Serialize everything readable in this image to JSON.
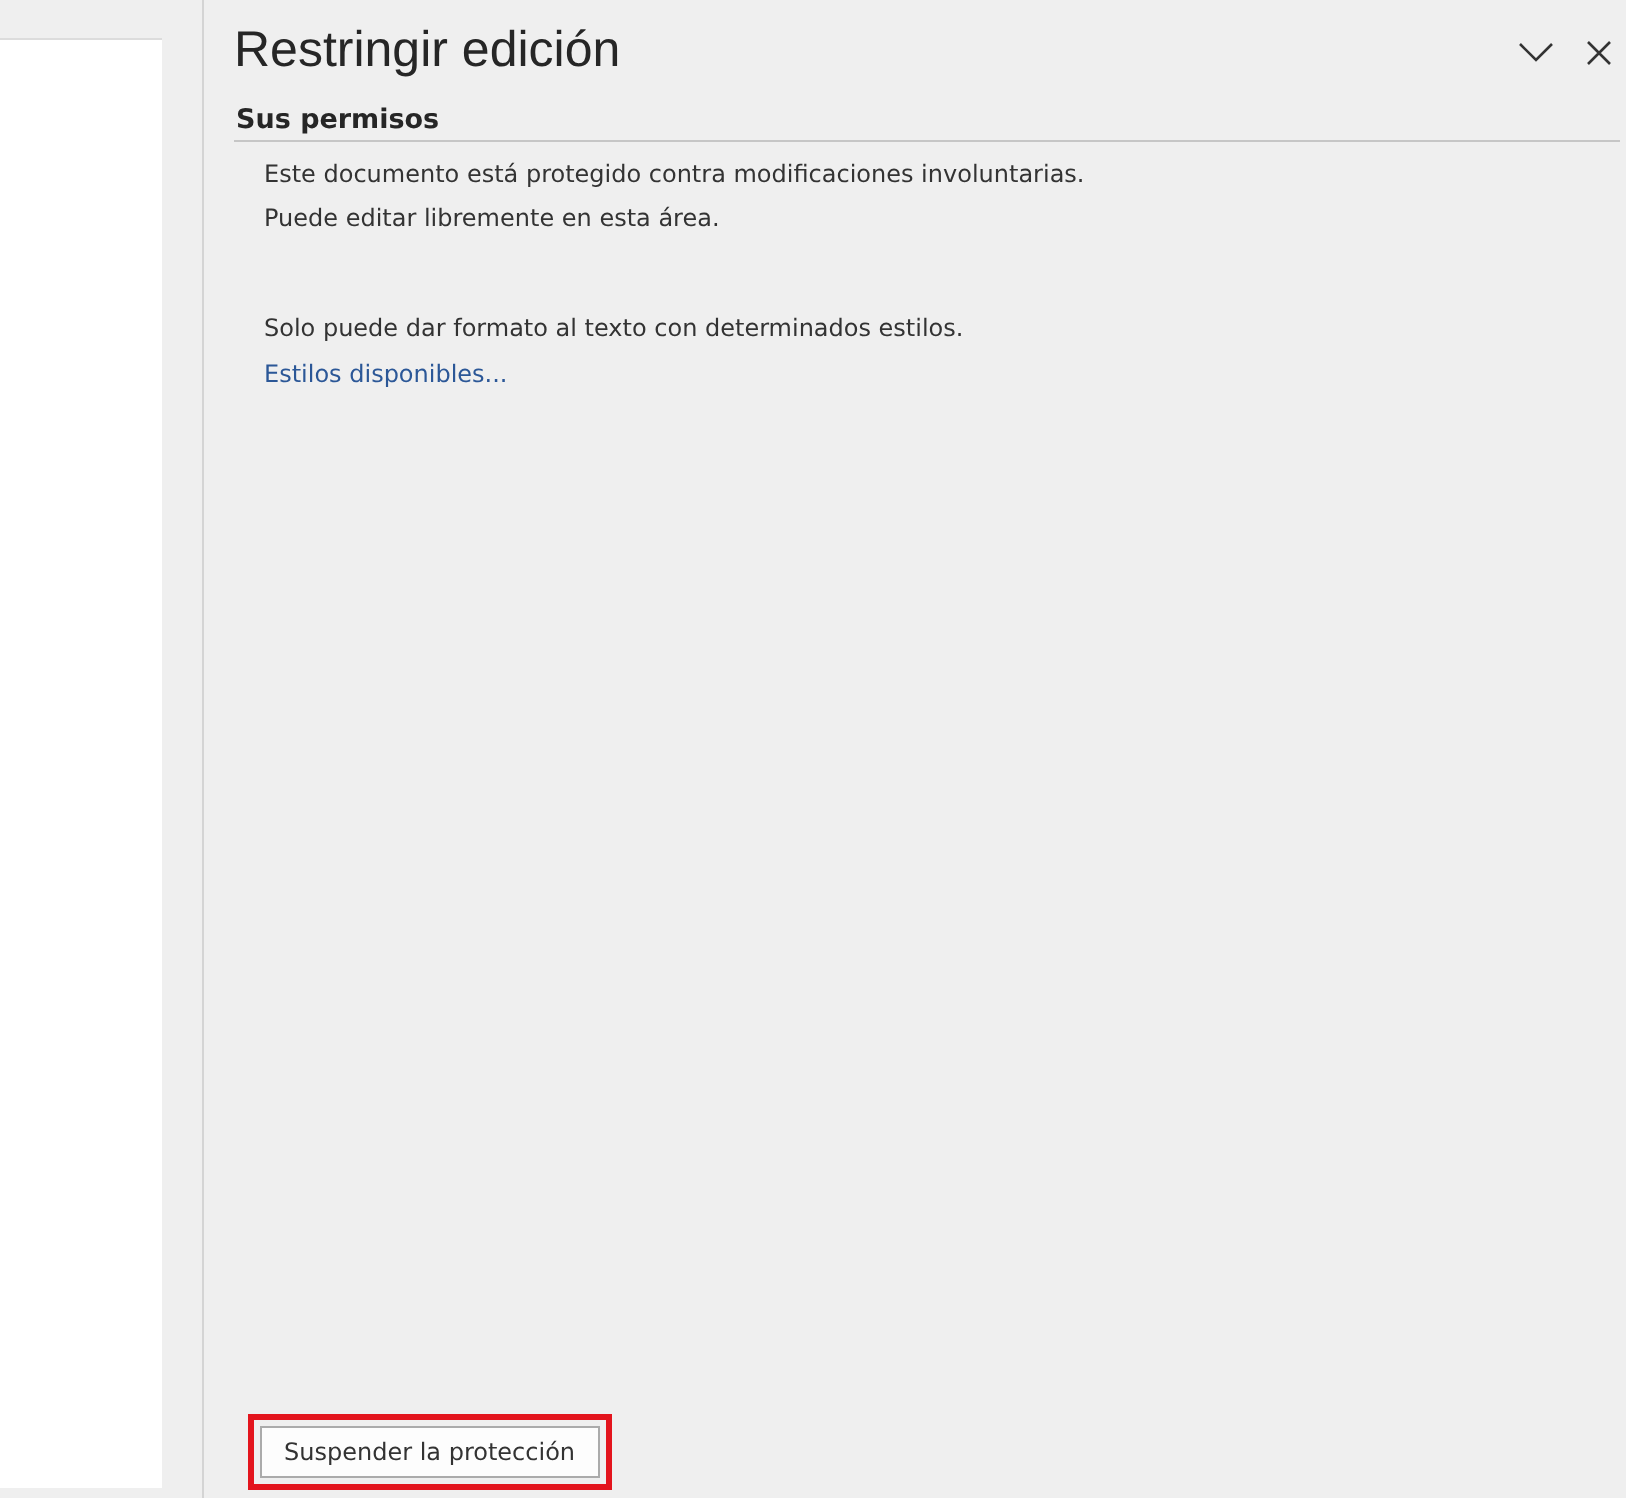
{
  "pane": {
    "title": "Restringir edición",
    "section": {
      "heading": "Sus permisos",
      "paragraphs": [
        {
          "kind": "text",
          "text": "Este documento está protegido contra modificaciones involuntarias."
        },
        {
          "kind": "text",
          "text": "Puede editar libremente en esta área."
        },
        {
          "kind": "gap"
        },
        {
          "kind": "text",
          "text": "Solo puede dar formato al texto con determinados estilos."
        },
        {
          "kind": "link",
          "text": "Estilos disponibles..."
        }
      ]
    },
    "button": {
      "label": "Suspender la protección",
      "highlighted": true
    }
  }
}
